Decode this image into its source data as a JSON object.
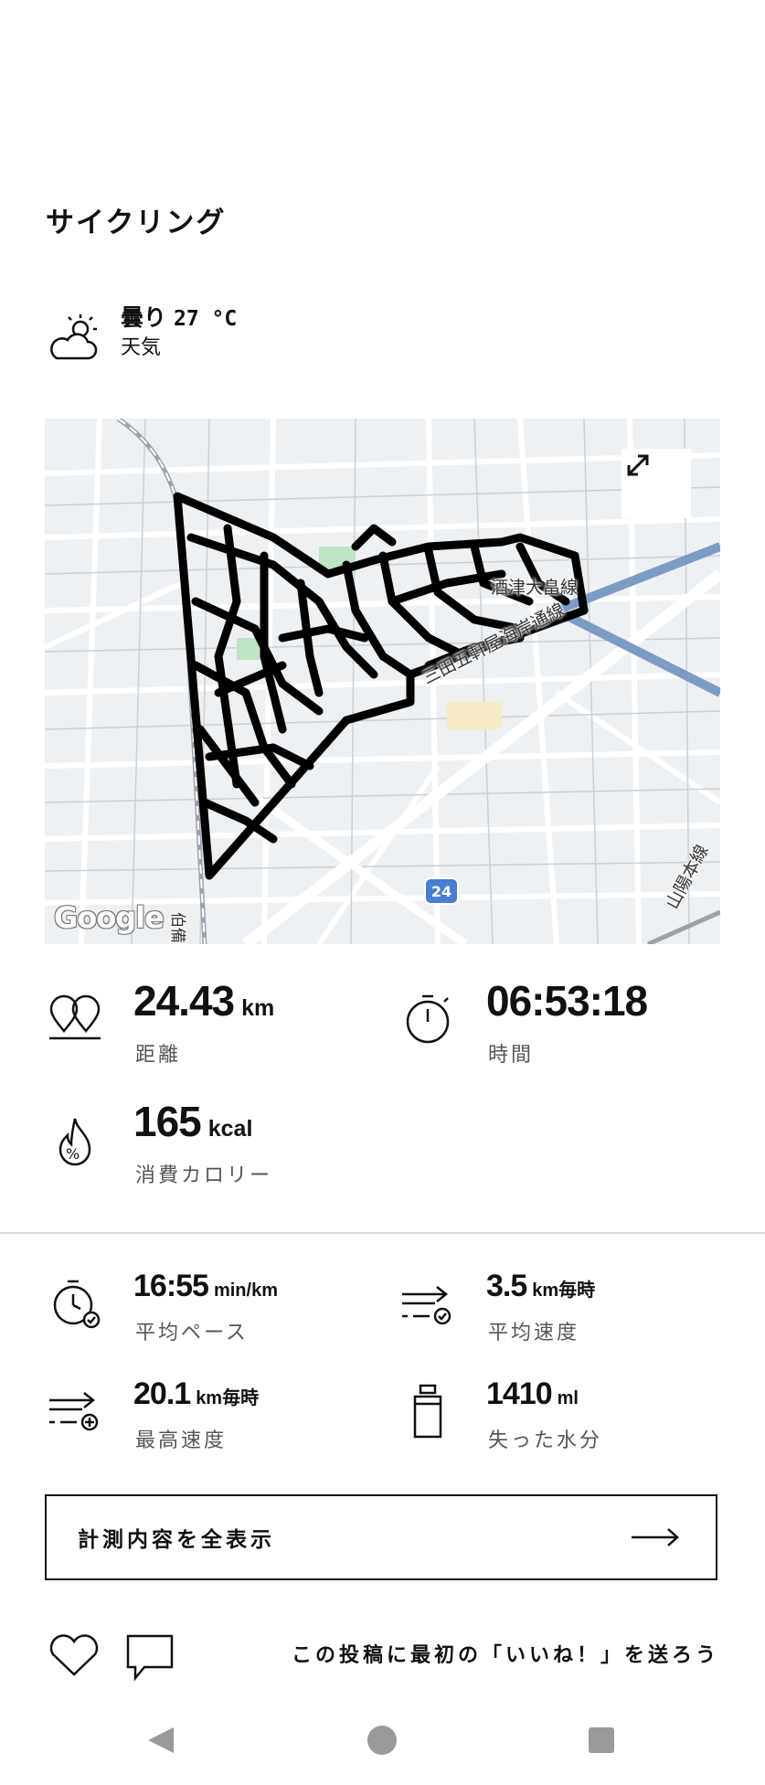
{
  "activity": {
    "title": "サイクリング"
  },
  "weather": {
    "icon": "partly-cloudy-icon",
    "condition": "曇り",
    "temperature": "27 °C",
    "label": "天気"
  },
  "map": {
    "attribution": "Google",
    "expand_icon": "expand-icon",
    "roads": [
      "酒津大畠線",
      "三田五軒屋海岸通線",
      "山陽本線",
      "伯備"
    ],
    "route_shield": "24"
  },
  "stats": {
    "distance": {
      "value": "24.43",
      "unit": "km",
      "label": "距離",
      "icon": "distance-pin-icon"
    },
    "time": {
      "value": "06:53:18",
      "unit": "",
      "label": "時間",
      "icon": "stopwatch-icon"
    },
    "calories": {
      "value": "165",
      "unit": "kcal",
      "label": "消費カロリー",
      "icon": "calorie-flame-icon"
    }
  },
  "details": {
    "pace": {
      "value": "16:55",
      "unit": "min/km",
      "label": "平均ペース",
      "icon": "pace-clock-icon"
    },
    "avg_speed": {
      "value": "3.5",
      "unit": "km毎時",
      "label": "平均速度",
      "icon": "avg-speed-icon"
    },
    "max_speed": {
      "value": "20.1",
      "unit": "km毎時",
      "label": "最高速度",
      "icon": "max-speed-icon"
    },
    "water": {
      "value": "1410",
      "unit": "ml",
      "label": "失った水分",
      "icon": "water-bottle-icon"
    }
  },
  "actions": {
    "show_all_label": "計測内容を全表示",
    "like_prompt": "この投稿に最初の「いいね！」を送ろう"
  },
  "colors": {
    "accent_road": "#7d9cc5",
    "route": "#000000"
  }
}
